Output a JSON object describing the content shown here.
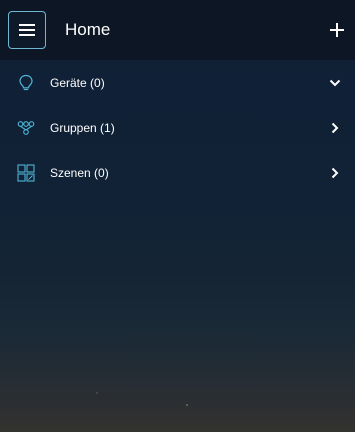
{
  "header": {
    "title": "Home",
    "menu_icon": "hamburger-menu-icon",
    "add_icon": "plus-icon"
  },
  "list": {
    "items": [
      {
        "label": "Geräte (0)",
        "icon": "lightbulb-icon",
        "chevron": "chevron-down-icon"
      },
      {
        "label": "Gruppen (1)",
        "icon": "group-icon",
        "chevron": "chevron-right-icon"
      },
      {
        "label": "Szenen (0)",
        "icon": "scenes-icon",
        "chevron": "chevron-right-icon"
      }
    ]
  },
  "colors": {
    "accent": "#4fb6d8",
    "text": "#ffffff",
    "header_bg": "#0c1624"
  }
}
